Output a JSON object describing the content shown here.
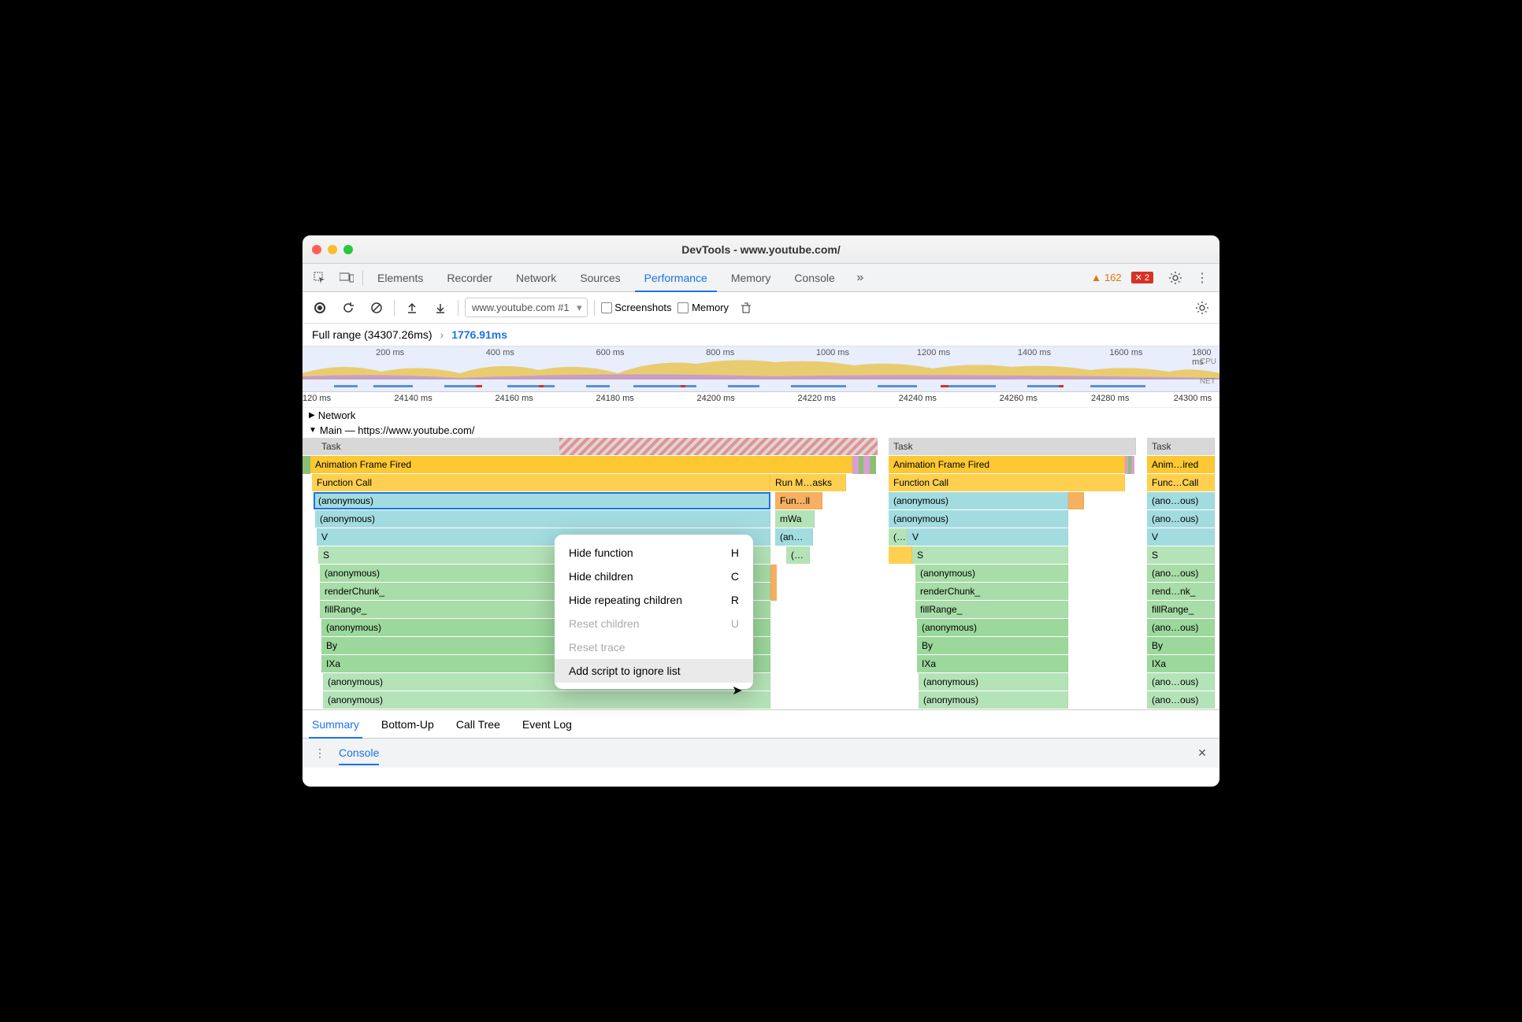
{
  "window": {
    "title": "DevTools - www.youtube.com/"
  },
  "tabs": {
    "items": [
      "Elements",
      "Recorder",
      "Network",
      "Sources",
      "Performance",
      "Memory",
      "Console"
    ],
    "active_index": 4
  },
  "badges": {
    "warnings": "162",
    "errors": "2"
  },
  "toolbar": {
    "dropdown": "www.youtube.com #1",
    "screenshots_label": "Screenshots",
    "memory_label": "Memory"
  },
  "breadcrumb": {
    "full_label": "Full range (34307.26ms)",
    "current": "1776.91ms"
  },
  "overview_ticks": [
    "200 ms",
    "400 ms",
    "600 ms",
    "800 ms",
    "1000 ms",
    "1200 ms",
    "1400 ms",
    "1600 ms",
    "1800 ms"
  ],
  "overview_labels": {
    "cpu": "CPU",
    "net": "NET"
  },
  "ruler_ticks": [
    "120 ms",
    "24140 ms",
    "24160 ms",
    "24180 ms",
    "24200 ms",
    "24220 ms",
    "24240 ms",
    "24260 ms",
    "24280 ms",
    "24300 ms"
  ],
  "track_network": "Network",
  "track_main": "Main — https://www.youtube.com/",
  "flame": {
    "task": "Task",
    "aff": "Animation Frame Fired",
    "fc": "Function Call",
    "anon": "(anonymous)",
    "v": "V",
    "s": "S",
    "renderChunk": "renderChunk_",
    "fillRange": "fillRange_",
    "by": "By",
    "ixa": "IXa",
    "runm": "Run M…asks",
    "funll": "Fun…ll",
    "mwa": "mWa",
    "ans": "(an…s)",
    "paren": "(…",
    "animired": "Anim…ired",
    "funccall": "Func…Call",
    "anoous": "(ano…ous)",
    "rendnk": "rend…nk_"
  },
  "context_menu": {
    "items": [
      {
        "label": "Hide function",
        "shortcut": "H",
        "disabled": false
      },
      {
        "label": "Hide children",
        "shortcut": "C",
        "disabled": false
      },
      {
        "label": "Hide repeating children",
        "shortcut": "R",
        "disabled": false
      },
      {
        "label": "Reset children",
        "shortcut": "U",
        "disabled": true
      },
      {
        "label": "Reset trace",
        "shortcut": "",
        "disabled": true
      },
      {
        "label": "Add script to ignore list",
        "shortcut": "",
        "disabled": false,
        "hovered": true
      }
    ]
  },
  "bottom_tabs": {
    "items": [
      "Summary",
      "Bottom-Up",
      "Call Tree",
      "Event Log"
    ],
    "active_index": 0
  },
  "console": {
    "label": "Console"
  }
}
